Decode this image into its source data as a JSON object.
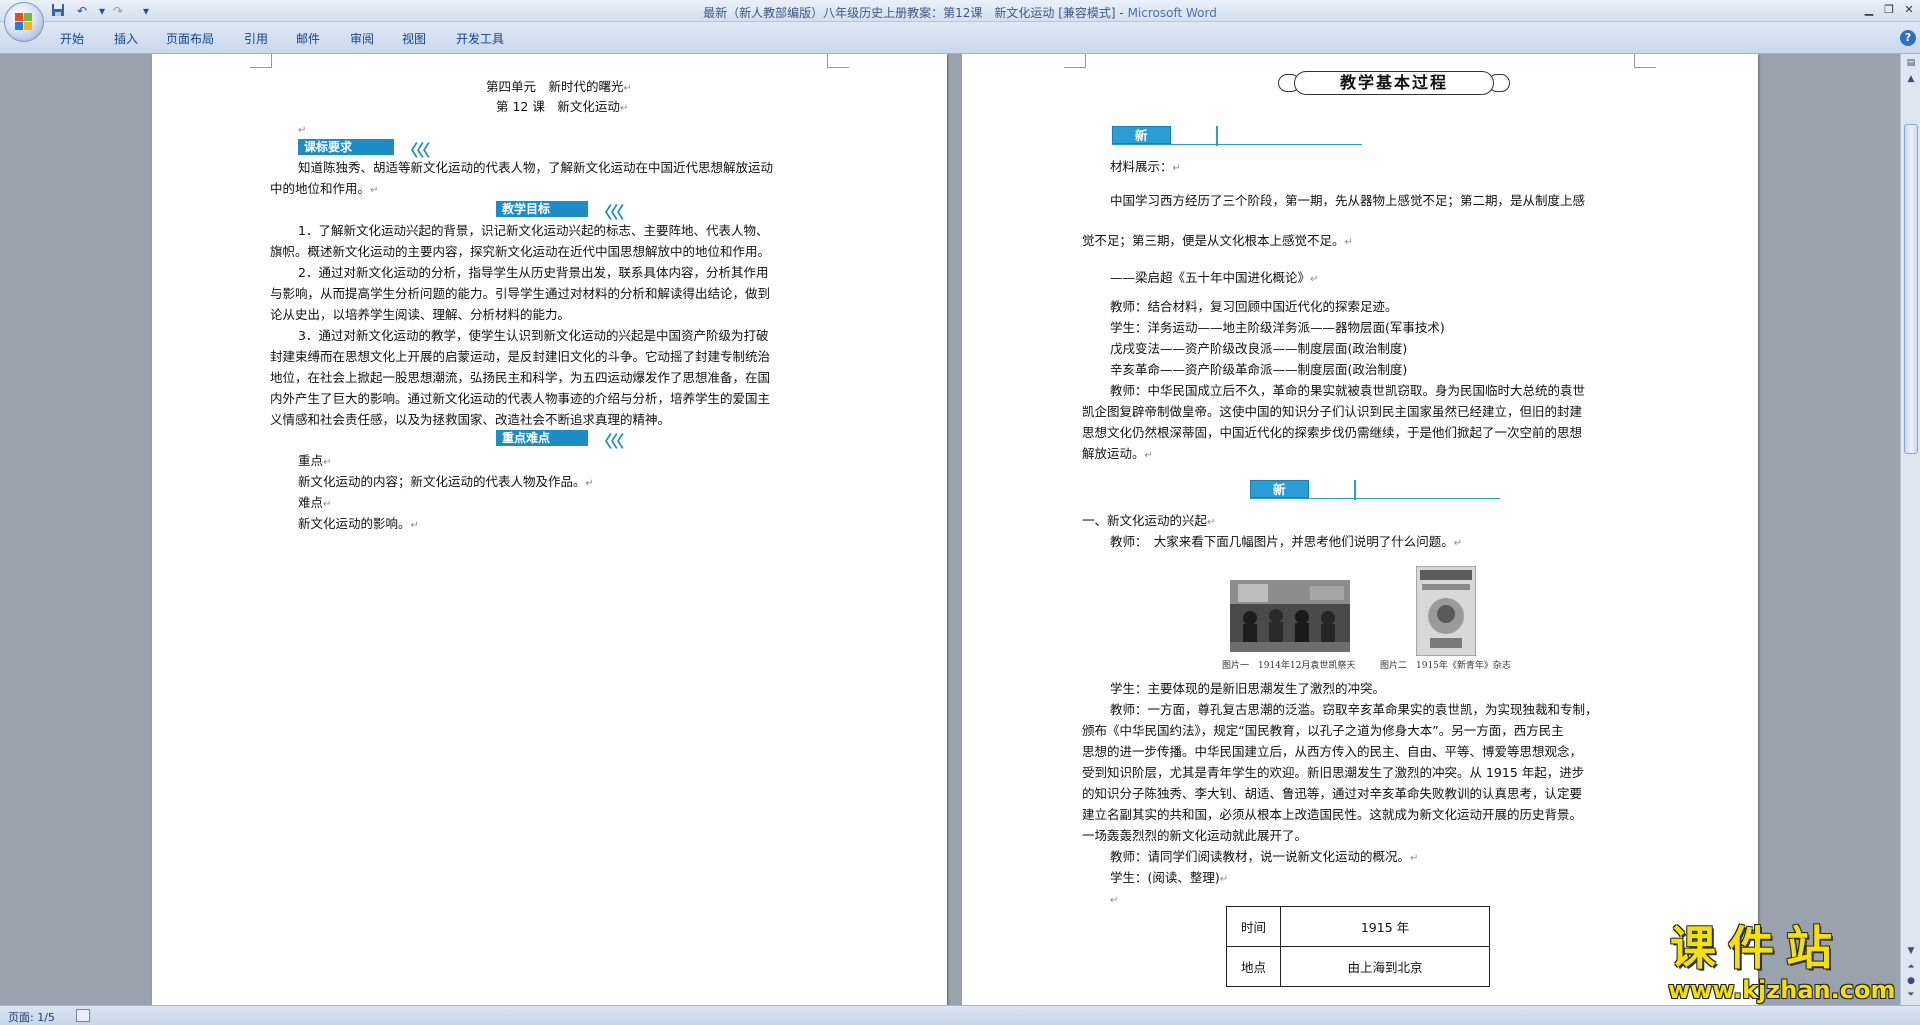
{
  "window": {
    "title_doc": "最新（新人教部编版）八年级历史上册教案：第12课　新文化运动 [兼容模式] - ",
    "title_app": "Microsoft Word"
  },
  "quick_access": {
    "save_icon": "save-icon",
    "undo_icon": "undo-icon",
    "redo_icon": "redo-icon",
    "more_icon": "chevron-down-icon"
  },
  "ribbon": {
    "tabs": [
      "开始",
      "插入",
      "页面布局",
      "引用",
      "邮件",
      "审阅",
      "视图",
      "开发工具"
    ]
  },
  "page1": {
    "unit_title": "第四单元　新时代的曙光",
    "lesson_title": "第 12 课　新文化运动",
    "section_requirements": "课标要求",
    "requirements_text": [
      "知道陈独秀、胡适等新文化运动的代表人物，了解新文化运动在中国近代思想解放运动",
      "中的地位和作用。"
    ],
    "section_goals": "教学目标",
    "goals": [
      "1．了解新文化运动兴起的背景，识记新文化运动兴起的标志、主要阵地、代表人物、",
      "旗帜。概述新文化运动的主要内容，探究新文化运动在近代中国思想解放中的地位和作用。",
      "2．通过对新文化运动的分析，指导学生从历史背景出发，联系具体内容，分析其作用",
      "与影响，从而提高学生分析问题的能力。引导学生通过对材料的分析和解读得出结论，做到",
      "论从史出，以培养学生阅读、理解、分析材料的能力。",
      "3．通过对新文化运动的教学，使学生认识到新文化运动的兴起是中国资产阶级为打破",
      "封建束缚而在思想文化上开展的启蒙运动，是反封建旧文化的斗争。它动摇了封建专制统治",
      "地位，在社会上掀起一股思想潮流，弘扬民主和科学，为五四运动爆发作了思想准备，在国",
      "内外产生了巨大的影响。通过新文化运动的代表人物事迹的介绍与分析，培养学生的爱国主",
      "义情感和社会责任感，以及为拯救国家、改造社会不断追求真理的精神。"
    ],
    "section_key": "重点难点",
    "key_label": "重点",
    "key_text": "新文化运动的内容；新文化运动的代表人物及作品。",
    "difficulty_label": "难点",
    "difficulty_text": "新文化运动的影响。"
  },
  "page2": {
    "process_title": "教学基本过程",
    "section_intro": "新课导入",
    "material_label": "材料展示：",
    "quote_line1": "中国学习西方经历了三个阶段，第一期，先从器物上感觉不足；第二期，是从制度上感",
    "quote_line2": "觉不足；第三期，便是从文化根本上感觉不足。",
    "quote_source": "——梁启超《五十年中国进化概论》",
    "intro_lines": [
      "教师：结合材料，复习回顾中国近代化的探索足迹。",
      "学生：洋务运动——地主阶级洋务派——器物层面(军事技术)",
      "戊戌变法——资产阶级改良派——制度层面(政治制度)",
      "辛亥革命——资产阶级革命派——制度层面(政治制度)",
      "教师：中华民国成立后不久，革命的果实就被袁世凯窃取。身为民国临时大总统的袁世",
      "凯企图复辟帝制做皇帝。这使中国的知识分子们认识到民主国家虽然已经建立，但旧的封建",
      "思想文化仍然根深蒂固，中国近代化的探索步伐仍需继续，于是他们掀起了一次空前的思想",
      "解放运动。"
    ],
    "section_explore": "新课探究",
    "sub_heading": "一、新文化运动的兴起",
    "teacher_prompt": "教师：　大家来看下面几幅图片，并思考他们说明了什么问题。",
    "caption1": "图片一　1914年12月袁世凯祭天",
    "caption2": "图片二　1915年《新青年》杂志",
    "body_lines": [
      "学生：主要体现的是新旧思潮发生了激烈的冲突。",
      "教师：一方面，尊孔复古思潮的泛滥。窃取辛亥革命果实的袁世凯，为实现独裁和专制，",
      "颁布《中华民国约法》，规定“国民教育，以孔子之道为修身大本”。另一方面，西方民主",
      "思想的进一步传播。中华民国建立后，从西方传入的民主、自由、平等、博爱等思想观念，",
      "受到知识阶层，尤其是青年学生的欢迎。新旧思潮发生了激烈的冲突。从 1915 年起，进步",
      "的知识分子陈独秀、李大钊、胡适、鲁迅等，通过对辛亥革命失败教训的认真思考，认定要",
      "建立名副其实的共和国，必须从根本上改造国民性。这就成为新文化运动开展的历史背景。",
      "一场轰轰烈烈的新文化运动就此展开了。",
      "教师：请同学们阅读教材，说一说新文化运动的概况。",
      "学生：(阅读、整理)"
    ],
    "table": [
      {
        "label": "时间",
        "value": "1915 年"
      },
      {
        "label": "地点",
        "value": "由上海到北京"
      }
    ]
  },
  "status": {
    "page": "页面: 1/5"
  },
  "watermark": {
    "title": "课件站",
    "url": "www.kjzhan.com"
  }
}
